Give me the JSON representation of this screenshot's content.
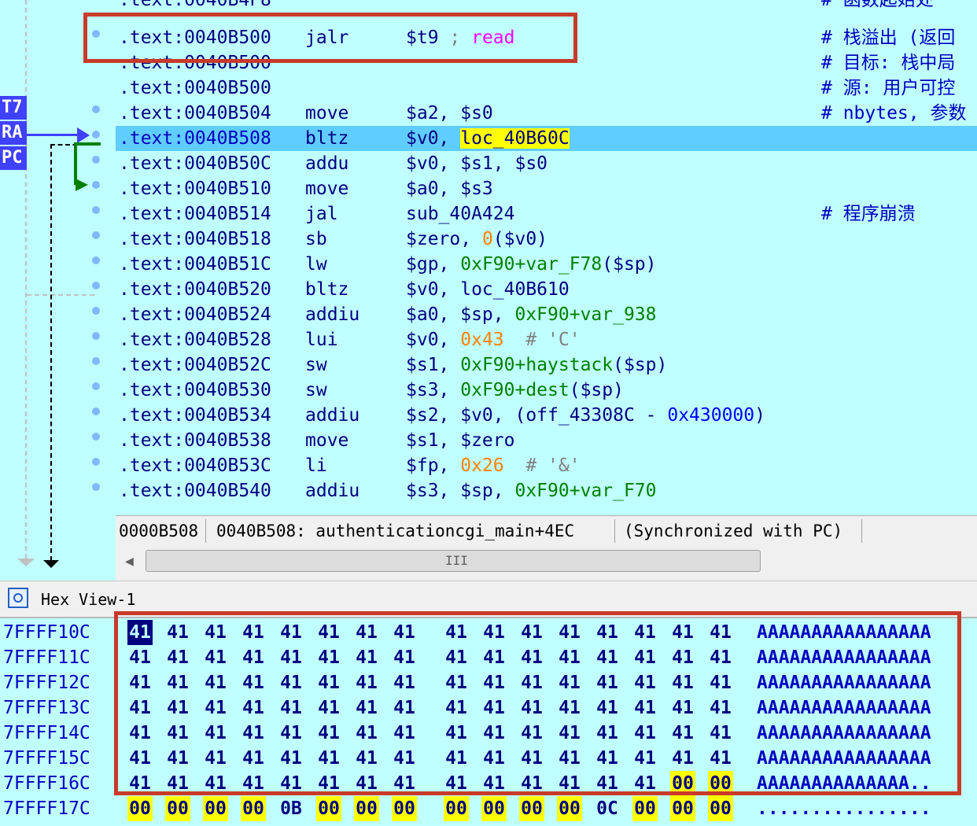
{
  "disasm": {
    "rows": [
      {
        "addr": ".text:0040B500",
        "mn": "jalr",
        "op_parts": [
          [
            "$t9 ",
            ""
          ],
          [
            "; ",
            "grey"
          ],
          [
            "read",
            "magenta"
          ]
        ],
        "comment": "# 栈溢出 (返回"
      },
      {
        "addr": ".text:0040B500",
        "mn": "",
        "op_parts": [],
        "comment": "# 目标: 栈中局"
      },
      {
        "addr": ".text:0040B500",
        "mn": "",
        "op_parts": [],
        "comment": "# 源: 用户可控"
      },
      {
        "addr": ".text:0040B504",
        "mn": "move",
        "op_parts": [
          [
            "$a2, $s0",
            ""
          ]
        ],
        "comment": "# nbytes, 参数"
      },
      {
        "addr": ".text:0040B508",
        "mn": "bltz",
        "op_parts": [
          [
            "$v0, ",
            ""
          ],
          [
            "loc_40B60C",
            "yellow"
          ]
        ],
        "comment": "",
        "selected": true
      },
      {
        "addr": ".text:0040B50C",
        "mn": "addu",
        "op_parts": [
          [
            "$v0, $s1, $s0",
            ""
          ]
        ],
        "comment": ""
      },
      {
        "addr": ".text:0040B510",
        "mn": "move",
        "op_parts": [
          [
            "$a0, $s3",
            ""
          ]
        ],
        "comment": ""
      },
      {
        "addr": ".text:0040B514",
        "mn": "jal",
        "op_parts": [
          [
            "sub_40A424",
            ""
          ]
        ],
        "comment": "# 程序崩溃"
      },
      {
        "addr": ".text:0040B518",
        "mn": "sb",
        "op_parts": [
          [
            "$zero, ",
            ""
          ],
          [
            "0",
            "orange"
          ],
          [
            "($v0)",
            ""
          ]
        ],
        "comment": ""
      },
      {
        "addr": ".text:0040B51C",
        "mn": "lw",
        "op_parts": [
          [
            "$gp, ",
            ""
          ],
          [
            "0xF90+var_F78",
            "green"
          ],
          [
            "($sp)",
            ""
          ]
        ],
        "comment": ""
      },
      {
        "addr": ".text:0040B520",
        "mn": "bltz",
        "op_parts": [
          [
            "$v0, loc_40B610",
            ""
          ]
        ],
        "comment": ""
      },
      {
        "addr": ".text:0040B524",
        "mn": "addiu",
        "op_parts": [
          [
            "$a0, $sp, ",
            ""
          ],
          [
            "0xF90+var_938",
            "green"
          ]
        ],
        "comment": ""
      },
      {
        "addr": ".text:0040B528",
        "mn": "lui",
        "op_parts": [
          [
            "$v0, ",
            ""
          ],
          [
            "0x43",
            "orange"
          ],
          [
            "  # 'C'",
            "grey"
          ]
        ],
        "comment": ""
      },
      {
        "addr": ".text:0040B52C",
        "mn": "sw",
        "op_parts": [
          [
            "$s1, ",
            ""
          ],
          [
            "0xF90+haystack",
            "green"
          ],
          [
            "($sp)",
            ""
          ]
        ],
        "comment": ""
      },
      {
        "addr": ".text:0040B530",
        "mn": "sw",
        "op_parts": [
          [
            "$s3, ",
            ""
          ],
          [
            "0xF90+dest",
            "green"
          ],
          [
            "($sp)",
            ""
          ]
        ],
        "comment": ""
      },
      {
        "addr": ".text:0040B534",
        "mn": "addiu",
        "op_parts": [
          [
            "$s2, $v0, (off_43308C - ",
            ""
          ],
          [
            "0x430000",
            "blue"
          ],
          [
            ")",
            ""
          ]
        ],
        "comment": ""
      },
      {
        "addr": ".text:0040B538",
        "mn": "move",
        "op_parts": [
          [
            "$s1, $zero",
            ""
          ]
        ],
        "comment": ""
      },
      {
        "addr": ".text:0040B53C",
        "mn": "li",
        "op_parts": [
          [
            "$fp, ",
            ""
          ],
          [
            "0x26",
            "orange"
          ],
          [
            "  # '&'",
            "grey"
          ]
        ],
        "comment": ""
      },
      {
        "addr": ".text:0040B540",
        "mn": "addiu",
        "op_parts": [
          [
            "$s3, $sp, ",
            ""
          ],
          [
            "0xF90+var_F70",
            "green"
          ]
        ],
        "comment": ""
      }
    ],
    "top_cut_text": ".text:0040B4F8",
    "top_comment": "# 函数起始处",
    "row3_cut_text": ".text:0040B500"
  },
  "gutter": {
    "registers": [
      "T7",
      "RA",
      "PC"
    ]
  },
  "status": {
    "offset": "0000B508",
    "location": "0040B508: authenticationcgi_main+4EC",
    "sync": "(Synchronized with PC)"
  },
  "scrollbar": {
    "grip": "III"
  },
  "hexview": {
    "title": "Hex View-1",
    "icon": "hex-view-icon",
    "rows": [
      {
        "addr": "7FFFF10C",
        "bytes": [
          "41",
          "41",
          "41",
          "41",
          "41",
          "41",
          "41",
          "41",
          "41",
          "41",
          "41",
          "41",
          "41",
          "41",
          "41",
          "41"
        ],
        "ascii": "AAAAAAAAAAAAAAAA"
      },
      {
        "addr": "7FFFF11C",
        "bytes": [
          "41",
          "41",
          "41",
          "41",
          "41",
          "41",
          "41",
          "41",
          "41",
          "41",
          "41",
          "41",
          "41",
          "41",
          "41",
          "41"
        ],
        "ascii": "AAAAAAAAAAAAAAAA"
      },
      {
        "addr": "7FFFF12C",
        "bytes": [
          "41",
          "41",
          "41",
          "41",
          "41",
          "41",
          "41",
          "41",
          "41",
          "41",
          "41",
          "41",
          "41",
          "41",
          "41",
          "41"
        ],
        "ascii": "AAAAAAAAAAAAAAAA"
      },
      {
        "addr": "7FFFF13C",
        "bytes": [
          "41",
          "41",
          "41",
          "41",
          "41",
          "41",
          "41",
          "41",
          "41",
          "41",
          "41",
          "41",
          "41",
          "41",
          "41",
          "41"
        ],
        "ascii": "AAAAAAAAAAAAAAAA"
      },
      {
        "addr": "7FFFF14C",
        "bytes": [
          "41",
          "41",
          "41",
          "41",
          "41",
          "41",
          "41",
          "41",
          "41",
          "41",
          "41",
          "41",
          "41",
          "41",
          "41",
          "41"
        ],
        "ascii": "AAAAAAAAAAAAAAAA"
      },
      {
        "addr": "7FFFF15C",
        "bytes": [
          "41",
          "41",
          "41",
          "41",
          "41",
          "41",
          "41",
          "41",
          "41",
          "41",
          "41",
          "41",
          "41",
          "41",
          "41",
          "41"
        ],
        "ascii": "AAAAAAAAAAAAAAAA"
      },
      {
        "addr": "7FFFF16C",
        "bytes": [
          "41",
          "41",
          "41",
          "41",
          "41",
          "41",
          "41",
          "41",
          "41",
          "41",
          "41",
          "41",
          "41",
          "41",
          "00",
          "00"
        ],
        "ascii": "AAAAAAAAAAAAAA.."
      },
      {
        "addr": "7FFFF17C",
        "bytes": [
          "00",
          "00",
          "00",
          "00",
          "0B",
          "00",
          "00",
          "00",
          "00",
          "00",
          "00",
          "00",
          "0C",
          "00",
          "00",
          "00"
        ],
        "ascii": "................"
      }
    ]
  },
  "colors": {
    "background": "#c0ffff",
    "selection": "#5fcdff",
    "annotation_red": "#c83a2a",
    "highlight_yellow": "#ffff00",
    "register_blue": "#4040ff"
  }
}
